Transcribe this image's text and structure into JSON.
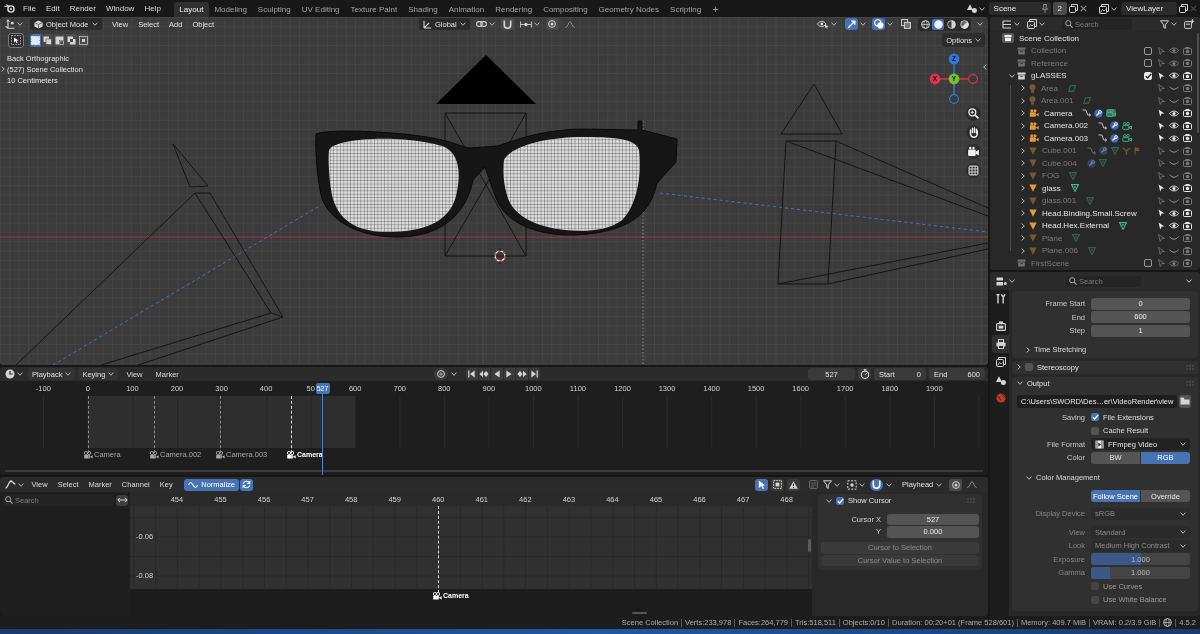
{
  "topbar": {
    "menus": [
      "File",
      "Edit",
      "Render",
      "Window",
      "Help"
    ],
    "workspaces": [
      {
        "label": "Layout",
        "selected": true
      },
      {
        "label": "Modeling",
        "selected": false
      },
      {
        "label": "Sculpting",
        "selected": false
      },
      {
        "label": "UV Editing",
        "selected": false
      },
      {
        "label": "Texture Paint",
        "selected": false
      },
      {
        "label": "Shading",
        "selected": false
      },
      {
        "label": "Animation",
        "selected": false
      },
      {
        "label": "Rendering",
        "selected": false
      },
      {
        "label": "Compositing",
        "selected": false
      },
      {
        "label": "Geometry Nodes",
        "selected": false
      },
      {
        "label": "Scripting",
        "selected": false
      }
    ],
    "add_workspace": "+",
    "scene": "Scene",
    "scene_users": "2",
    "view_layer": "ViewLayer"
  },
  "viewport": {
    "mode": "Object Mode",
    "menus": [
      "View",
      "Select",
      "Add",
      "Object"
    ],
    "orientation": "Global",
    "toggles": [
      {
        "kind": "gizmos",
        "on": true
      },
      {
        "kind": "overlays",
        "on": true
      },
      {
        "kind": "xray",
        "on": false
      }
    ],
    "shading_modes": [
      {
        "kind": "wireframe",
        "selected": false
      },
      {
        "kind": "solid",
        "selected": true
      },
      {
        "kind": "material",
        "selected": false
      },
      {
        "kind": "rendered",
        "selected": false
      }
    ],
    "select_modes": [
      {
        "kind": "set",
        "selected": true
      },
      {
        "kind": "extend",
        "selected": false
      },
      {
        "kind": "subtract",
        "selected": false
      },
      {
        "kind": "difference",
        "selected": false
      },
      {
        "kind": "intersect",
        "selected": false
      }
    ],
    "options": "Options",
    "info": [
      "Back Orthographic",
      "(527) Scene Collection",
      "10 Centimeters"
    ],
    "axes": [
      {
        "label": "Z",
        "color": "#2f7ad8"
      },
      {
        "label": "X",
        "color": "#d8344e"
      },
      {
        "label": "Y",
        "color": "#72c12a"
      }
    ]
  },
  "timeline": {
    "menus": [
      {
        "label": "Playback",
        "kind": "dropdown"
      },
      {
        "label": "Keying",
        "kind": "dropdown"
      },
      {
        "label": "View",
        "kind": "menu"
      },
      {
        "label": "Marker",
        "kind": "menu"
      }
    ],
    "current_frame": "527",
    "start_label": "Start",
    "start": "0",
    "end_label": "End",
    "end": "600",
    "ruler": [
      "-100",
      "0",
      "100",
      "200",
      "300",
      "400",
      "50",
      "600",
      "700",
      "800",
      "900",
      "1000",
      "1100",
      "1200",
      "1300",
      "1400",
      "1500",
      "1600",
      "1700",
      "1800",
      "1900"
    ],
    "playhead": "527",
    "markers": [
      {
        "label": "Camera",
        "selected": false
      },
      {
        "label": "Camera.002",
        "selected": false
      },
      {
        "label": "Camera.003",
        "selected": false
      },
      {
        "label": "Camera",
        "selected": true
      }
    ]
  },
  "graph": {
    "menus": [
      "View",
      "Select",
      "Marker",
      "Channel",
      "Key"
    ],
    "normalize": {
      "label": "Normalize",
      "on": true
    },
    "auto_normalize": {
      "on": true
    },
    "filters": [
      {
        "kind": "only_selected",
        "on": true
      },
      {
        "kind": "show_hidden",
        "on": false
      },
      {
        "kind": "only_errors",
        "on": false
      }
    ],
    "snapping": {
      "on": true
    },
    "pivot": "Playhead",
    "search_placeholder": "Search",
    "ruler": [
      "454",
      "455",
      "456",
      "457",
      "458",
      "459",
      "460",
      "461",
      "462",
      "463",
      "464",
      "465",
      "466",
      "467",
      "468"
    ],
    "y_ticks": [
      "-0.06",
      "-0.08"
    ],
    "marker": {
      "label": "Camera",
      "selected": true
    },
    "cursor_panel": {
      "label": "Show Cursor",
      "checked": true,
      "expanded": true,
      "fields": [
        {
          "label": "Cursor X",
          "value": "527"
        },
        {
          "label": "Y",
          "value": "0.000"
        }
      ],
      "buttons": [
        {
          "label": "Cursor to Selection",
          "disabled": true
        },
        {
          "label": "Cursor Value to Selection",
          "disabled": true
        }
      ]
    }
  },
  "outliner": {
    "search_placeholder": "Search",
    "items": [
      {
        "label": "Scene Collection",
        "kind": "scene",
        "children": [
          {
            "label": "Collection",
            "kind": "collection",
            "included": false
          },
          {
            "label": "Reference",
            "kind": "collection",
            "included": false
          },
          {
            "label": "gLASSES",
            "kind": "collection",
            "included": true,
            "expanded": true,
            "children": [
              {
                "label": "Area",
                "kind": "light",
                "expanded": false,
                "visible": false,
                "extras": [
                  {
                    "kind": "light-data",
                    "selected": false
                  }
                ]
              },
              {
                "label": "Area.001",
                "kind": "light",
                "expanded": false,
                "visible": false,
                "extras": [
                  {
                    "kind": "light-data",
                    "selected": false
                  }
                ]
              },
              {
                "label": "Camera",
                "kind": "camera",
                "expanded": false,
                "visible": true,
                "extras": [
                  {
                    "kind": "constraint",
                    "selected": false
                  },
                  {
                    "kind": "modifier",
                    "selected": false
                  },
                  {
                    "kind": "camera-data",
                    "selected": true
                  }
                ]
              },
              {
                "label": "Camera.002",
                "kind": "camera",
                "expanded": false,
                "visible": true,
                "extras": [
                  {
                    "kind": "constraint",
                    "selected": false
                  },
                  {
                    "kind": "modifier",
                    "selected": false
                  },
                  {
                    "kind": "camera-data",
                    "selected": false
                  }
                ]
              },
              {
                "label": "Camera.003",
                "kind": "camera",
                "expanded": false,
                "visible": true,
                "extras": [
                  {
                    "kind": "constraint",
                    "selected": false
                  },
                  {
                    "kind": "modifier",
                    "selected": false
                  },
                  {
                    "kind": "camera-data",
                    "selected": false
                  }
                ]
              },
              {
                "label": "Cube.001",
                "kind": "mesh",
                "expanded": false,
                "visible": false,
                "extras": [
                  {
                    "kind": "constraint",
                    "selected": false
                  },
                  {
                    "kind": "modifier",
                    "selected": false
                  },
                  {
                    "kind": "mesh-data",
                    "selected": false
                  },
                  {
                    "kind": "branch",
                    "selected": false
                  },
                  {
                    "kind": "flag",
                    "selected": false
                  }
                ]
              },
              {
                "label": "Cube.004",
                "kind": "mesh",
                "expanded": false,
                "visible": false,
                "extras": [
                  {
                    "kind": "modifier",
                    "selected": false
                  },
                  {
                    "kind": "mesh-data",
                    "selected": false
                  }
                ]
              },
              {
                "label": "FOG",
                "kind": "mesh",
                "expanded": false,
                "visible": false,
                "extras": [
                  {
                    "kind": "mesh-data",
                    "selected": false
                  }
                ]
              },
              {
                "label": "glass",
                "kind": "mesh",
                "expanded": false,
                "visible": true,
                "extras": [
                  {
                    "kind": "mesh-data",
                    "selected": false
                  }
                ]
              },
              {
                "label": "glass.001",
                "kind": "mesh",
                "expanded": false,
                "visible": false,
                "extras": [
                  {
                    "kind": "mesh-data",
                    "selected": false
                  }
                ]
              },
              {
                "label": "Head.Binding.Small.Screw",
                "kind": "mesh",
                "expanded": false,
                "visible": true
              },
              {
                "label": "Head.Hex.External",
                "kind": "mesh",
                "expanded": false,
                "visible": true,
                "extras": [
                  {
                    "kind": "mesh-data",
                    "selected": false
                  }
                ]
              },
              {
                "label": "Plane",
                "kind": "mesh",
                "expanded": false,
                "visible": false,
                "extras": [
                  {
                    "kind": "mesh-data",
                    "selected": false
                  }
                ]
              },
              {
                "label": "Plane.006",
                "kind": "mesh",
                "expanded": false,
                "visible": false,
                "extras": [
                  {
                    "kind": "mesh-data",
                    "selected": false
                  }
                ]
              }
            ]
          },
          {
            "label": "FirstScene",
            "kind": "collection",
            "included": false
          }
        ]
      }
    ]
  },
  "properties": {
    "search_placeholder": "Search",
    "tabs": [
      {
        "kind": "tool",
        "selected": false
      },
      {
        "kind": "render",
        "selected": false
      },
      {
        "kind": "output",
        "selected": true
      },
      {
        "kind": "view_layer",
        "selected": false
      },
      {
        "kind": "scene",
        "selected": false
      },
      {
        "kind": "world",
        "selected": false
      }
    ],
    "frame_range": [
      {
        "label": "Frame Start",
        "value": "0"
      },
      {
        "label": "End",
        "value": "600"
      },
      {
        "label": "Step",
        "value": "1"
      }
    ],
    "time_stretching": {
      "label": "Time Stretching",
      "expanded": false
    },
    "stereoscopy": {
      "label": "Stereoscopy",
      "expanded": false,
      "checked": false
    },
    "output": {
      "label": "Output",
      "expanded": true,
      "path": "C:\\Users\\SWORD\\Des…er\\VideoRender\\view",
      "saving_label": "Saving",
      "file_extensions": {
        "label": "File Extensions",
        "checked": true
      },
      "cache_result": {
        "label": "Cache Result",
        "checked": false
      },
      "file_format_label": "File Format",
      "file_format": "FFmpeg Video",
      "color_label": "Color",
      "color_options": [
        {
          "label": "BW",
          "selected": false
        },
        {
          "label": "RGB",
          "selected": true
        }
      ]
    },
    "color_management": {
      "label": "Color Management",
      "expanded": true,
      "modes": [
        {
          "label": "Follow Scene",
          "selected": true
        },
        {
          "label": "Override",
          "selected": false
        }
      ],
      "fields": [
        {
          "kind": "dropdown",
          "label": "Display Device",
          "value": "sRGB",
          "disabled": true
        },
        {
          "kind": "dropdown",
          "label": "View",
          "value": "Standard",
          "disabled": true
        },
        {
          "kind": "dropdown",
          "label": "Look",
          "value": "Medium High Contrast",
          "disabled": true
        },
        {
          "kind": "slider",
          "label": "Exposure",
          "value": "1.000",
          "level": 0.5,
          "disabled": true
        },
        {
          "kind": "slider",
          "label": "Gamma",
          "value": "1.000",
          "level": 0.19,
          "disabled": true
        },
        {
          "kind": "checkbox",
          "label": "Use Curves",
          "checked": false,
          "disabled": true
        },
        {
          "kind": "checkbox",
          "label": "Use White Balance",
          "checked": false,
          "disabled": true
        }
      ]
    }
  },
  "status_bar": {
    "items": [
      "Scene Collection",
      "Verts:233,978",
      "Faces:264,779",
      "Tris:518,511",
      "Objects:0/10",
      "Duration: 00:20+01 (Frame 528/601)",
      "Memory: 409.7 MiB",
      "VRAM: 0.2/3.9 GiB"
    ],
    "version": "4.5.2"
  }
}
